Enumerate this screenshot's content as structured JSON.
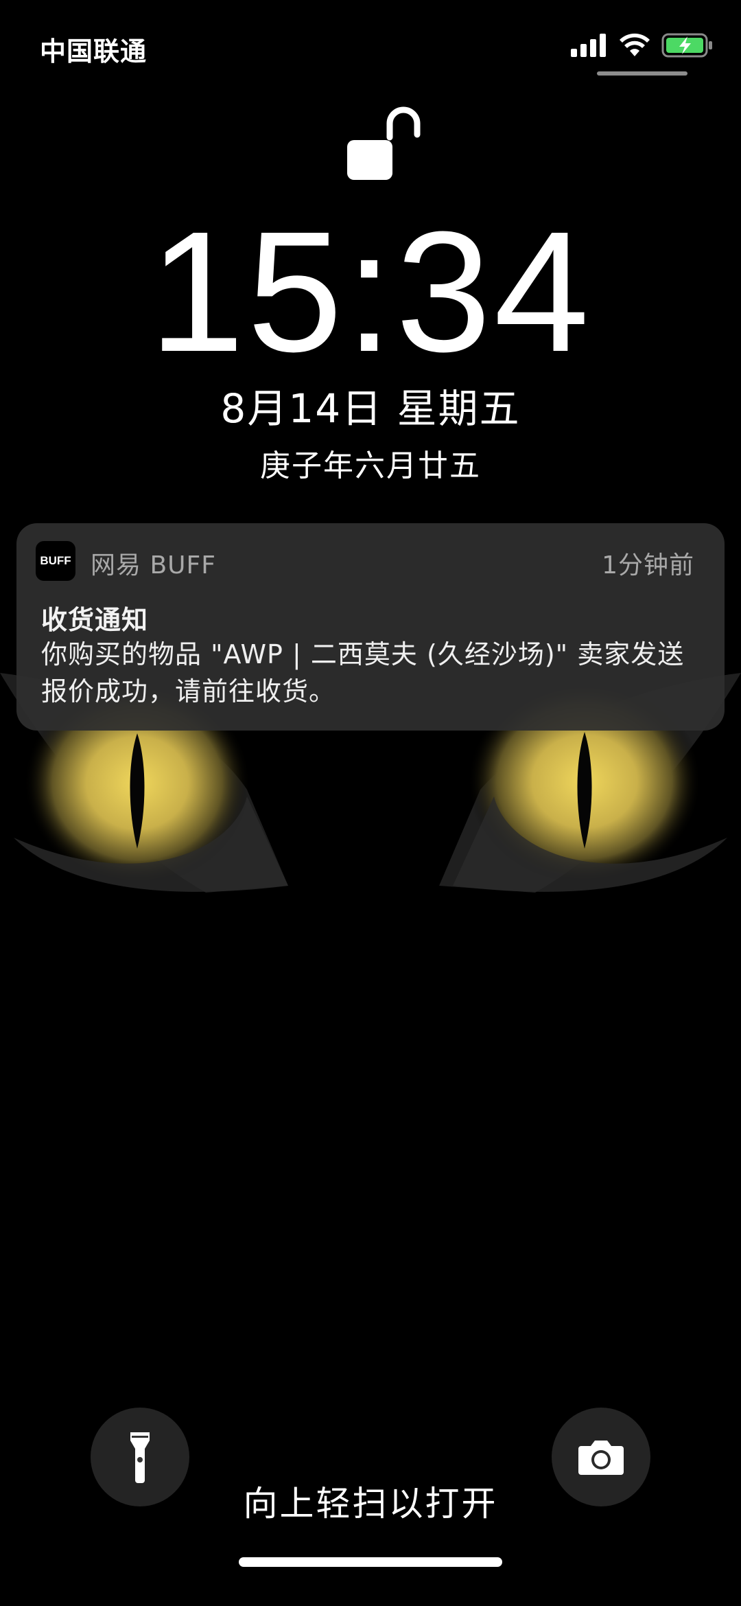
{
  "status_bar": {
    "carrier": "中国联通",
    "icons": [
      "signal-icon",
      "wifi-icon",
      "battery-charging-icon"
    ],
    "battery_color": "#4cd964"
  },
  "lock_screen": {
    "lock_icon": "unlocked-padlock-icon",
    "time": "15:34",
    "date": "8月14日 星期五",
    "lunar_date": "庚子年六月廿五"
  },
  "notification": {
    "app_icon_text": "BUFF",
    "app_name": "网易 BUFF",
    "time_ago": "1分钟前",
    "title": "收货通知",
    "body": "你购买的物品 \"AWP | 二西莫夫 (久经沙场)\" 卖家发送报价成功，请前往收货。"
  },
  "bottom": {
    "left_button_icon": "flashlight-icon",
    "right_button_icon": "camera-icon",
    "swipe_hint": "向上轻扫以打开"
  },
  "colors": {
    "background": "#000000",
    "notification_bg": "#2e2e2e",
    "eye_color": "#e8d060"
  }
}
